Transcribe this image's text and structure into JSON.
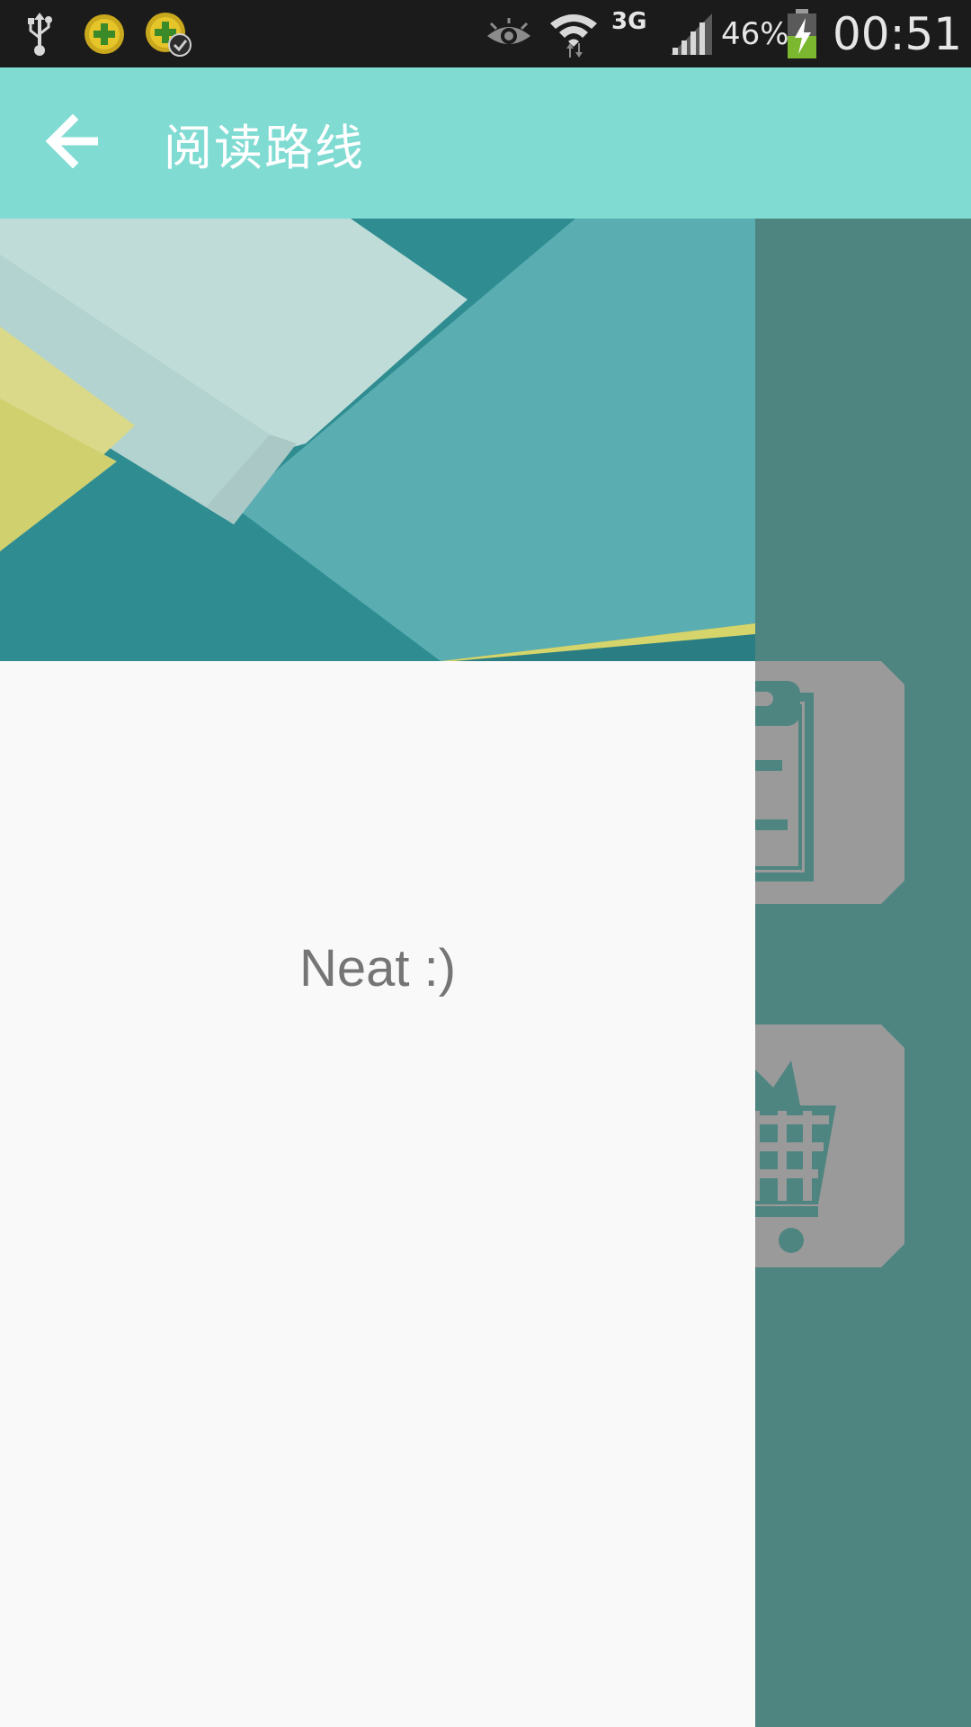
{
  "status_bar": {
    "network": "3G",
    "battery": "46%",
    "time": "00:51",
    "icons": [
      "usb-icon",
      "app-notification-icon",
      "app-notification-check-icon",
      "eye-icon",
      "wifi-icon",
      "signal-icon",
      "battery-charging-icon"
    ]
  },
  "app_bar": {
    "back_icon": "arrow-back-icon",
    "title": "阅读路线",
    "color": "#80dbd2"
  },
  "background_page": {
    "tiles": [
      "clipboard-icon",
      "shopping-cart-icon"
    ],
    "color": "#4f8580"
  },
  "drawer": {
    "header_image": "material-design-wallpaper",
    "message": "Neat :)"
  }
}
